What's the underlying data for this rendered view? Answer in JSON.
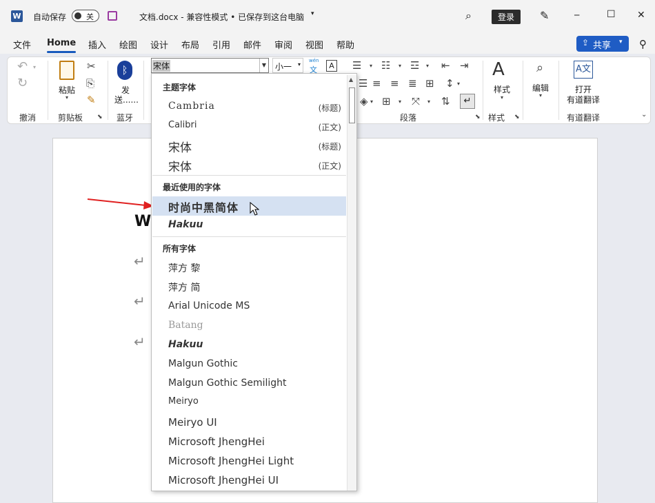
{
  "titlebar": {
    "autosave_label": "自动保存",
    "autosave_state": "关",
    "doc_title": "文档.docx  -  兼容性模式 • 已保存到这台电脑",
    "login_label": "登录",
    "minimize": "─",
    "maximize": "☐",
    "close": "✕"
  },
  "menu": {
    "tabs": [
      "文件",
      "Home",
      "插入",
      "绘图",
      "设计",
      "布局",
      "引用",
      "邮件",
      "审阅",
      "视图",
      "帮助"
    ],
    "share_label": "共享"
  },
  "ribbon": {
    "groups": {
      "undo": "撤消",
      "clipboard": "剪贴板",
      "bluetooth": "蓝牙",
      "paragraph": "段落",
      "styles": "样式",
      "youdao": "有道翻译"
    },
    "paste_label": "粘贴",
    "send_label": "发",
    "send_label2": "送......",
    "styles_label": "样式",
    "edit_label": "编辑",
    "open_label": "打开",
    "open_label2": "有道翻译",
    "font_value": "宋体",
    "size_value": "小一",
    "wen_label": "wén",
    "wen_char": "文",
    "a_char": "A"
  },
  "document": {
    "visible_text": "W"
  },
  "font_dropdown": {
    "theme_header": "主题字体",
    "theme_fonts": [
      {
        "name": "Cambria",
        "tag": "(标题)"
      },
      {
        "name": "Calibri",
        "tag": "(正文)"
      },
      {
        "name": "宋体",
        "tag": "(标题)"
      },
      {
        "name": "宋体",
        "tag": "(正文)"
      }
    ],
    "recent_header": "最近使用的字体",
    "recent_fonts": [
      "时尚中黑简体",
      "Hakuu"
    ],
    "all_header": "所有字体",
    "all_fonts": [
      "萍方 黎",
      "萍方 简",
      "Arial Unicode MS",
      "Batang",
      "Hakuu",
      "Malgun Gothic",
      "Malgun Gothic Semilight",
      "Meiryo",
      "Meiryo UI",
      "Microsoft JhengHei",
      "Microsoft JhengHei Light",
      "Microsoft JhengHei UI"
    ]
  },
  "colors": {
    "accent": "#185abd",
    "share_bg": "#1f5cc4",
    "highlight": "#d5e1f2",
    "arrow": "#e02020"
  }
}
